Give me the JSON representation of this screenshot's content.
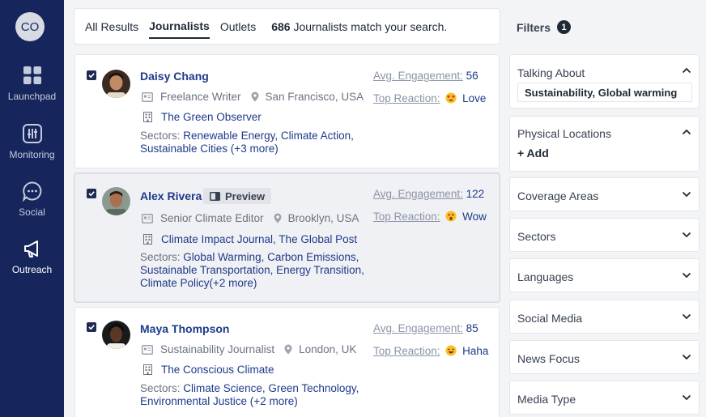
{
  "sidebar": {
    "avatar_initials": "CO",
    "items": [
      {
        "label": "Launchpad",
        "icon": "grid-icon"
      },
      {
        "label": "Monitoring",
        "icon": "equalizer-icon"
      },
      {
        "label": "Social",
        "icon": "chat-bubble-icon"
      },
      {
        "label": "Outreach",
        "icon": "megaphone-icon"
      }
    ]
  },
  "tabs": {
    "all_results": "All Results",
    "journalists": "Journalists",
    "outlets": "Outlets",
    "match_count": "686",
    "match_text": "Journalists match your search."
  },
  "results": [
    {
      "name": "Daisy Chang",
      "role": "Freelance Writer",
      "location": "San Francisco, USA",
      "outlet": "The Green Observer",
      "sectors_label": "Sectors:",
      "sectors": "Renewable Energy, Climate Action, Sustainable Cities (+3 more)",
      "engagement_label": "Avg. Engagement:",
      "engagement": "56",
      "reaction_label": "Top Reaction:",
      "reaction": "Love",
      "reaction_icon": "heart-eyes-emoji",
      "checked": true
    },
    {
      "name": "Alex Rivera",
      "preview_label": "Preview",
      "role": "Senior Climate Editor",
      "location": "Brooklyn, USA",
      "outlet": "Climate Impact Journal, The Global Post",
      "sectors_label": "Sectors:",
      "sectors": "Global Warming, Carbon Emissions, Sustainable Transportation, Energy Transition, Climate Policy(+2 more)",
      "engagement_label": "Avg. Engagement:",
      "engagement": "122",
      "reaction_label": "Top Reaction:",
      "reaction": "Wow",
      "reaction_icon": "surprised-emoji",
      "checked": true
    },
    {
      "name": "Maya Thompson",
      "role": "Sustainability Journalist",
      "location": "London, UK",
      "outlet": "The Conscious Climate",
      "sectors_label": "Sectors:",
      "sectors": "Climate Science, Green Technology, Environmental Justice (+2 more)",
      "engagement_label": "Avg. Engagement:",
      "engagement": "85",
      "reaction_label": "Top Reaction:",
      "reaction": "Haha",
      "reaction_icon": "laughing-emoji",
      "checked": true
    }
  ],
  "filters": {
    "title": "Filters",
    "count": "1",
    "talking_about": {
      "label": "Talking About",
      "value": "Sustainability, Global warming"
    },
    "physical_locations": {
      "label": "Physical Locations",
      "add": "+ Add"
    },
    "collapsed": [
      "Coverage Areas",
      "Sectors",
      "Languages",
      "Social Media",
      "News Focus",
      "Media Type"
    ]
  },
  "colors": {
    "sidebar_bg": "#16265c",
    "link_blue": "#1e3a8a",
    "muted": "#6b7280"
  }
}
